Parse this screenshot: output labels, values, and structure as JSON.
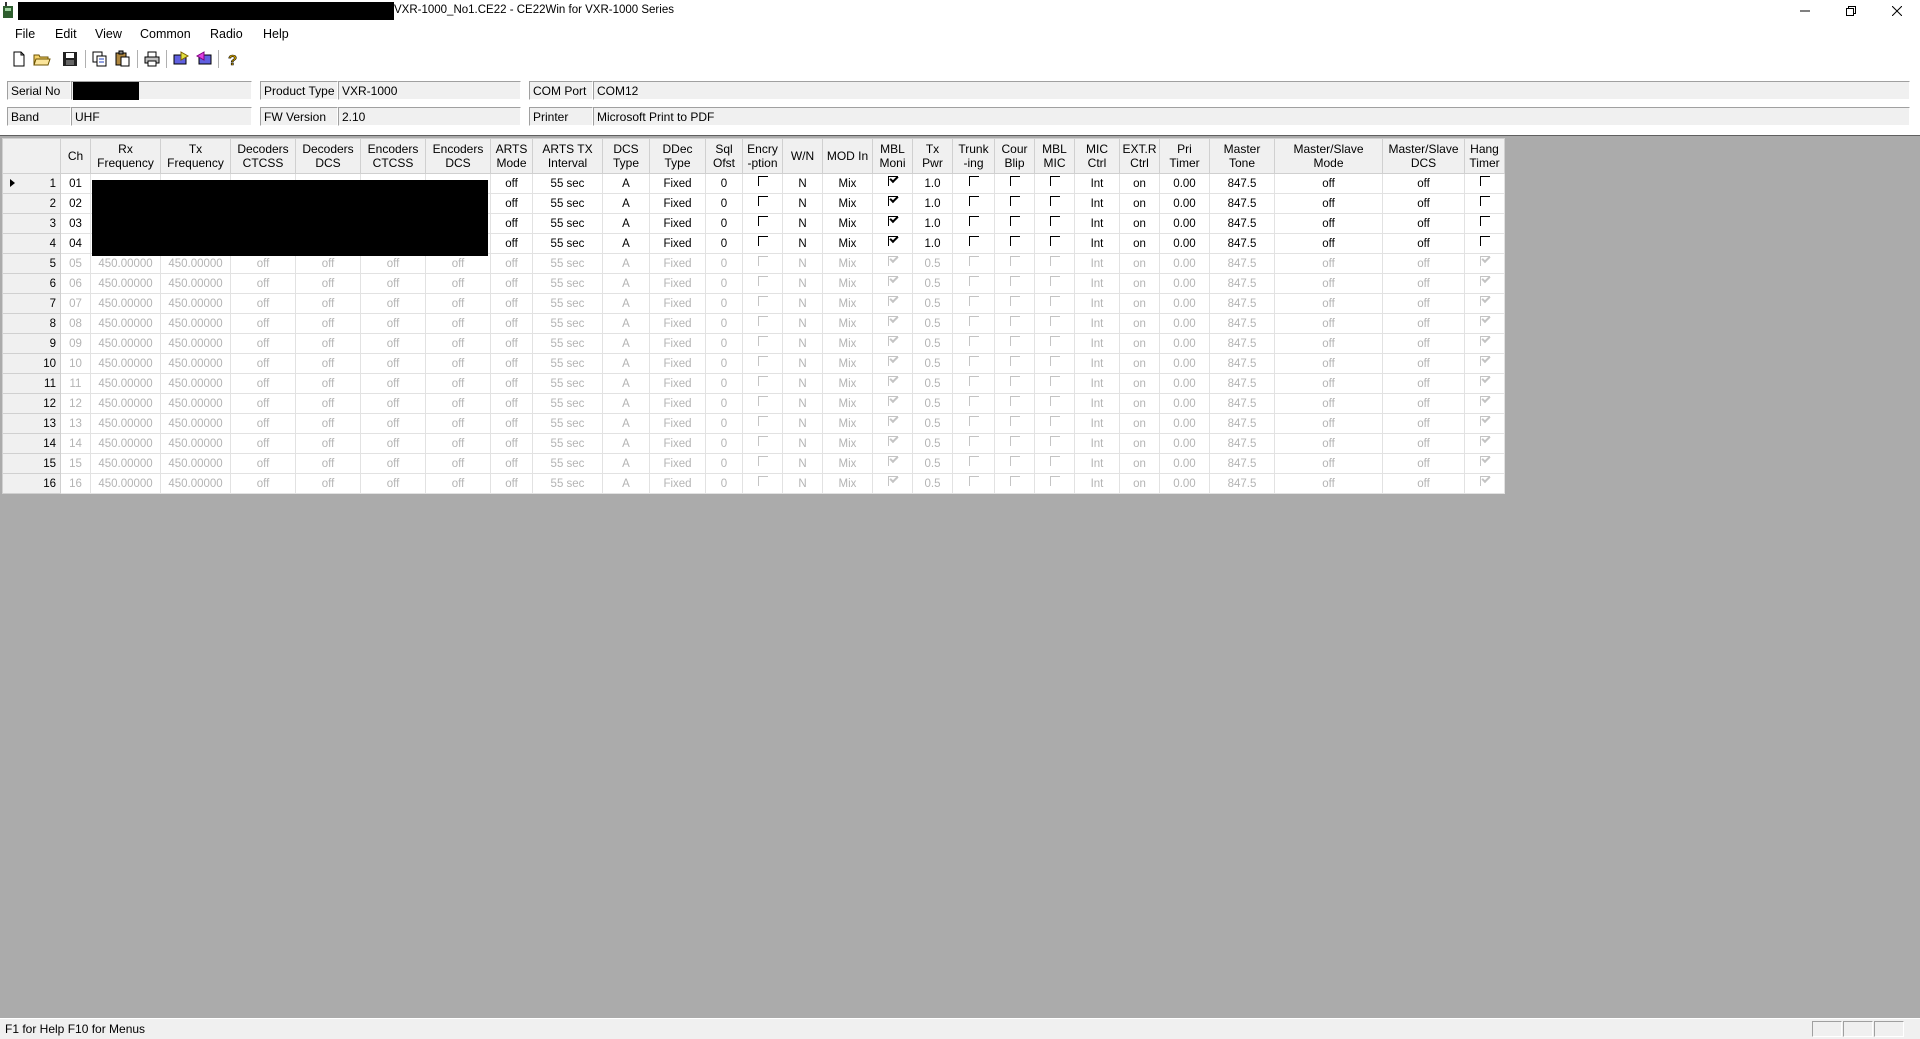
{
  "window": {
    "title": "VXR-1000_No1.CE22 - CE22Win for VXR-1000 Series",
    "controls": [
      "minimize",
      "restore",
      "close"
    ]
  },
  "menu": [
    "File",
    "Edit",
    "View",
    "Common",
    "Radio",
    "Help"
  ],
  "toolbar": [
    "new-file",
    "open-folder",
    "save",
    "copy",
    "paste",
    "print",
    "read-radio",
    "write-radio",
    "help"
  ],
  "info": {
    "serial_label": "Serial No",
    "serial_value": "",
    "band_label": "Band",
    "band_value": "UHF",
    "product_label": "Product Type",
    "product_value": "VXR-1000",
    "fw_label": "FW Version",
    "fw_value": "2.10",
    "com_label": "COM Port",
    "com_value": "COM12",
    "printer_label": "Printer",
    "printer_value": "Microsoft Print to PDF"
  },
  "grid": {
    "headers": [
      "Ch",
      "Rx\nFrequency",
      "Tx\nFrequency",
      "Decoders\nCTCSS",
      "Decoders\nDCS",
      "Encoders\nCTCSS",
      "Encoders\nDCS",
      "ARTS\nMode",
      "ARTS TX\nInterval",
      "DCS\nType",
      "DDec\nType",
      "Sql\nOfst",
      "Encry\n-ption",
      "W/N",
      "MOD In",
      "MBL\nMoni",
      "Tx\nPwr",
      "Trunk\n-ing",
      "Cour\nBlip",
      "MBL\nMIC",
      "MIC\nCtrl",
      "EXT.R\nCtrl",
      "Pri\nTimer",
      "Master\nTone",
      "Master/Slave\nMode",
      "Master/Slave\nDCS",
      "Hang\nTimer"
    ],
    "rows": [
      {
        "n": "1",
        "active": true,
        "current": true,
        "v": [
          "01",
          "",
          "",
          "",
          "",
          "",
          "",
          "off",
          "55 sec",
          "A",
          "Fixed",
          "0",
          false,
          "N",
          "Mix",
          true,
          "1.0",
          false,
          false,
          false,
          "Int",
          "on",
          "0.00",
          "847.5",
          "off",
          "off",
          false
        ]
      },
      {
        "n": "2",
        "active": true,
        "v": [
          "02",
          "",
          "",
          "",
          "",
          "",
          "",
          "off",
          "55 sec",
          "A",
          "Fixed",
          "0",
          false,
          "N",
          "Mix",
          true,
          "1.0",
          false,
          false,
          false,
          "Int",
          "on",
          "0.00",
          "847.5",
          "off",
          "off",
          false
        ]
      },
      {
        "n": "3",
        "active": true,
        "v": [
          "03",
          "",
          "",
          "",
          "",
          "",
          "",
          "off",
          "55 sec",
          "A",
          "Fixed",
          "0",
          false,
          "N",
          "Mix",
          true,
          "1.0",
          false,
          false,
          false,
          "Int",
          "on",
          "0.00",
          "847.5",
          "off",
          "off",
          false
        ]
      },
      {
        "n": "4",
        "active": true,
        "v": [
          "04",
          "",
          "",
          "",
          "",
          "",
          "",
          "off",
          "55 sec",
          "A",
          "Fixed",
          "0",
          false,
          "N",
          "Mix",
          true,
          "1.0",
          false,
          false,
          false,
          "Int",
          "on",
          "0.00",
          "847.5",
          "off",
          "off",
          false
        ]
      },
      {
        "n": "5",
        "active": false,
        "v": [
          "05",
          "450.00000",
          "450.00000",
          "off",
          "off",
          "off",
          "off",
          "off",
          "55 sec",
          "A",
          "Fixed",
          "0",
          false,
          "N",
          "Mix",
          true,
          "0.5",
          false,
          false,
          false,
          "Int",
          "on",
          "0.00",
          "847.5",
          "off",
          "off",
          true
        ]
      },
      {
        "n": "6",
        "active": false,
        "v": [
          "06",
          "450.00000",
          "450.00000",
          "off",
          "off",
          "off",
          "off",
          "off",
          "55 sec",
          "A",
          "Fixed",
          "0",
          false,
          "N",
          "Mix",
          true,
          "0.5",
          false,
          false,
          false,
          "Int",
          "on",
          "0.00",
          "847.5",
          "off",
          "off",
          true
        ]
      },
      {
        "n": "7",
        "active": false,
        "v": [
          "07",
          "450.00000",
          "450.00000",
          "off",
          "off",
          "off",
          "off",
          "off",
          "55 sec",
          "A",
          "Fixed",
          "0",
          false,
          "N",
          "Mix",
          true,
          "0.5",
          false,
          false,
          false,
          "Int",
          "on",
          "0.00",
          "847.5",
          "off",
          "off",
          true
        ]
      },
      {
        "n": "8",
        "active": false,
        "v": [
          "08",
          "450.00000",
          "450.00000",
          "off",
          "off",
          "off",
          "off",
          "off",
          "55 sec",
          "A",
          "Fixed",
          "0",
          false,
          "N",
          "Mix",
          true,
          "0.5",
          false,
          false,
          false,
          "Int",
          "on",
          "0.00",
          "847.5",
          "off",
          "off",
          true
        ]
      },
      {
        "n": "9",
        "active": false,
        "v": [
          "09",
          "450.00000",
          "450.00000",
          "off",
          "off",
          "off",
          "off",
          "off",
          "55 sec",
          "A",
          "Fixed",
          "0",
          false,
          "N",
          "Mix",
          true,
          "0.5",
          false,
          false,
          false,
          "Int",
          "on",
          "0.00",
          "847.5",
          "off",
          "off",
          true
        ]
      },
      {
        "n": "10",
        "active": false,
        "v": [
          "10",
          "450.00000",
          "450.00000",
          "off",
          "off",
          "off",
          "off",
          "off",
          "55 sec",
          "A",
          "Fixed",
          "0",
          false,
          "N",
          "Mix",
          true,
          "0.5",
          false,
          false,
          false,
          "Int",
          "on",
          "0.00",
          "847.5",
          "off",
          "off",
          true
        ]
      },
      {
        "n": "11",
        "active": false,
        "v": [
          "11",
          "450.00000",
          "450.00000",
          "off",
          "off",
          "off",
          "off",
          "off",
          "55 sec",
          "A",
          "Fixed",
          "0",
          false,
          "N",
          "Mix",
          true,
          "0.5",
          false,
          false,
          false,
          "Int",
          "on",
          "0.00",
          "847.5",
          "off",
          "off",
          true
        ]
      },
      {
        "n": "12",
        "active": false,
        "v": [
          "12",
          "450.00000",
          "450.00000",
          "off",
          "off",
          "off",
          "off",
          "off",
          "55 sec",
          "A",
          "Fixed",
          "0",
          false,
          "N",
          "Mix",
          true,
          "0.5",
          false,
          false,
          false,
          "Int",
          "on",
          "0.00",
          "847.5",
          "off",
          "off",
          true
        ]
      },
      {
        "n": "13",
        "active": false,
        "v": [
          "13",
          "450.00000",
          "450.00000",
          "off",
          "off",
          "off",
          "off",
          "off",
          "55 sec",
          "A",
          "Fixed",
          "0",
          false,
          "N",
          "Mix",
          true,
          "0.5",
          false,
          false,
          false,
          "Int",
          "on",
          "0.00",
          "847.5",
          "off",
          "off",
          true
        ]
      },
      {
        "n": "14",
        "active": false,
        "v": [
          "14",
          "450.00000",
          "450.00000",
          "off",
          "off",
          "off",
          "off",
          "off",
          "55 sec",
          "A",
          "Fixed",
          "0",
          false,
          "N",
          "Mix",
          true,
          "0.5",
          false,
          false,
          false,
          "Int",
          "on",
          "0.00",
          "847.5",
          "off",
          "off",
          true
        ]
      },
      {
        "n": "15",
        "active": false,
        "v": [
          "15",
          "450.00000",
          "450.00000",
          "off",
          "off",
          "off",
          "off",
          "off",
          "55 sec",
          "A",
          "Fixed",
          "0",
          false,
          "N",
          "Mix",
          true,
          "0.5",
          false,
          false,
          false,
          "Int",
          "on",
          "0.00",
          "847.5",
          "off",
          "off",
          true
        ]
      },
      {
        "n": "16",
        "active": false,
        "v": [
          "16",
          "450.00000",
          "450.00000",
          "off",
          "off",
          "off",
          "off",
          "off",
          "55 sec",
          "A",
          "Fixed",
          "0",
          false,
          "N",
          "Mix",
          true,
          "0.5",
          false,
          false,
          false,
          "Int",
          "on",
          "0.00",
          "847.5",
          "off",
          "off",
          true
        ]
      }
    ]
  },
  "status": {
    "text": "F1 for Help F10 for Menus"
  }
}
